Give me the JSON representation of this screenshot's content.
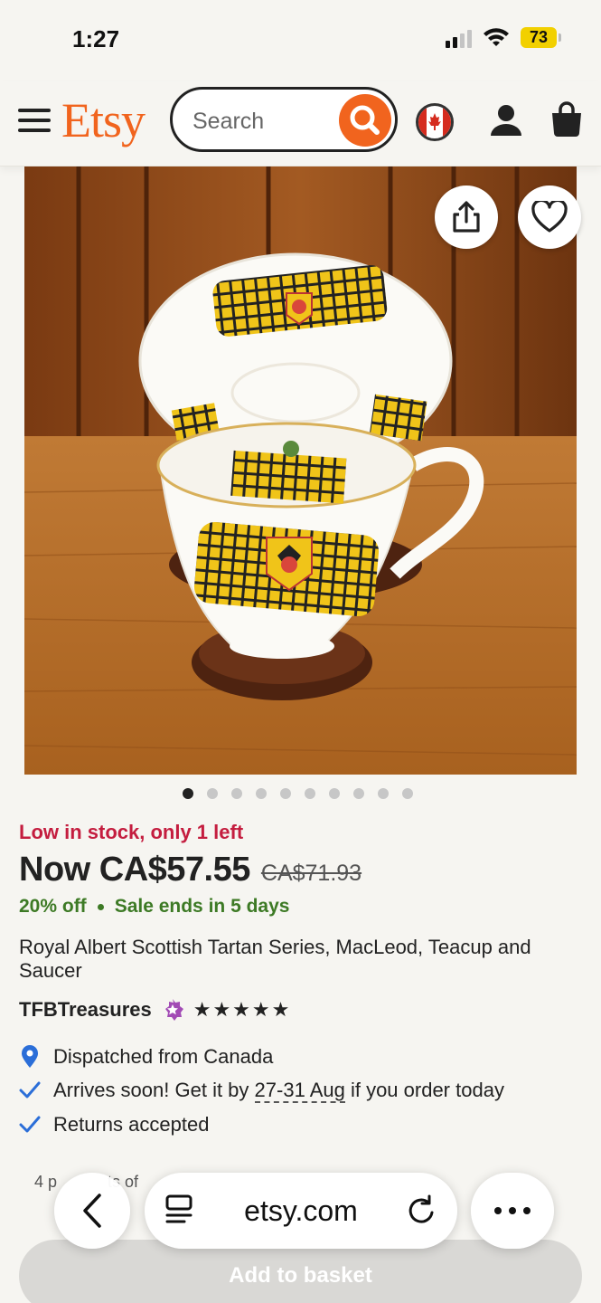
{
  "status_bar": {
    "time": "1:27",
    "battery": "73"
  },
  "header": {
    "logo": "Etsy",
    "search_placeholder": "Search"
  },
  "gallery": {
    "image_count": 10,
    "active_index": 0
  },
  "product": {
    "stock_note": "Low in stock, only 1 left",
    "price_now": "Now CA$57.55",
    "price_was": "CA$71.93",
    "discount": "20% off",
    "sale_ends": "Sale ends in 5 days",
    "title": "Royal Albert Scottish Tartan Series, MacLeod, Teacup and Saucer",
    "shop_name": "TFBTreasures",
    "rating_stars": "★★★★★",
    "rating": 5
  },
  "delivery": {
    "dispatched": "Dispatched from Canada",
    "arrives_prefix": "Arrives soon! Get it by ",
    "arrives_date": "27-31 Aug",
    "arrives_suffix": " if you order today",
    "returns": "Returns accepted"
  },
  "basket_note": "4 p",
  "basket_note_2": "ts of",
  "browser": {
    "url": "etsy.com"
  },
  "cta": {
    "add_to_basket": "Add to basket"
  },
  "colors": {
    "brand": "#f1641e",
    "stock": "#c41d3f",
    "sale": "#3d7a25",
    "location_pin": "#2b6ed8",
    "star_seller": "#a24bb5"
  }
}
